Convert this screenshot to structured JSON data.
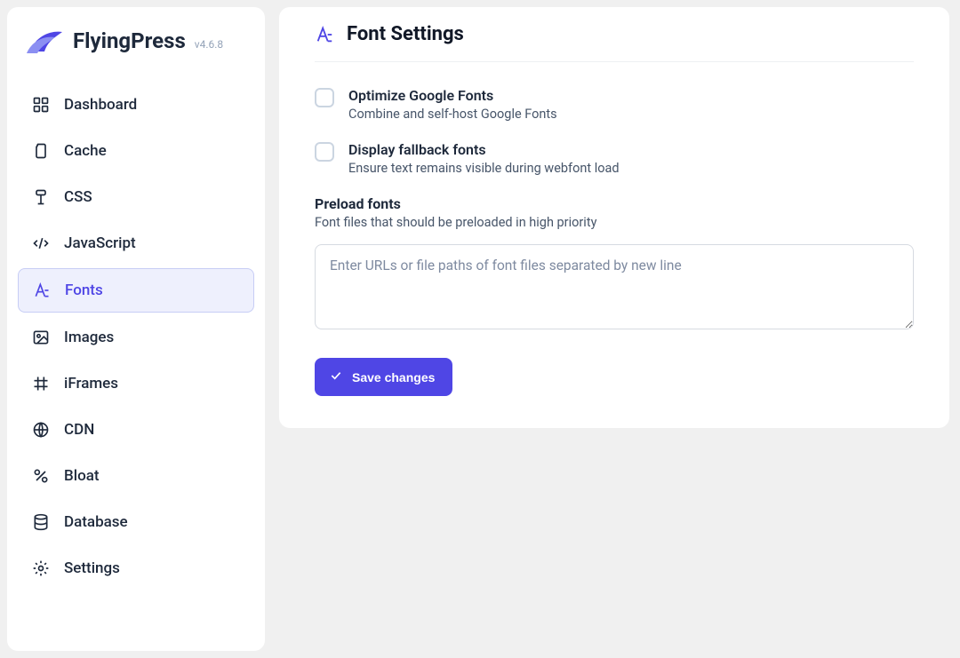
{
  "brand": {
    "name": "FlyingPress",
    "version": "v4.6.8"
  },
  "sidebar": {
    "items": [
      {
        "label": "Dashboard"
      },
      {
        "label": "Cache"
      },
      {
        "label": "CSS"
      },
      {
        "label": "JavaScript"
      },
      {
        "label": "Fonts"
      },
      {
        "label": "Images"
      },
      {
        "label": "iFrames"
      },
      {
        "label": "CDN"
      },
      {
        "label": "Bloat"
      },
      {
        "label": "Database"
      },
      {
        "label": "Settings"
      }
    ],
    "active_index": 4
  },
  "panel": {
    "title": "Font Settings",
    "optimize": {
      "title": "Optimize Google Fonts",
      "desc": "Combine and self-host Google Fonts",
      "checked": false
    },
    "fallback": {
      "title": "Display fallback fonts",
      "desc": "Ensure text remains visible during webfont load",
      "checked": false
    },
    "preload": {
      "title": "Preload fonts",
      "desc": "Font files that should be preloaded in high priority",
      "placeholder": "Enter URLs or file paths of font files separated by new line",
      "value": ""
    },
    "save_label": "Save changes"
  },
  "colors": {
    "accent": "#4f46e5",
    "active_bg": "#eef0fd",
    "text": "#1e293b"
  }
}
